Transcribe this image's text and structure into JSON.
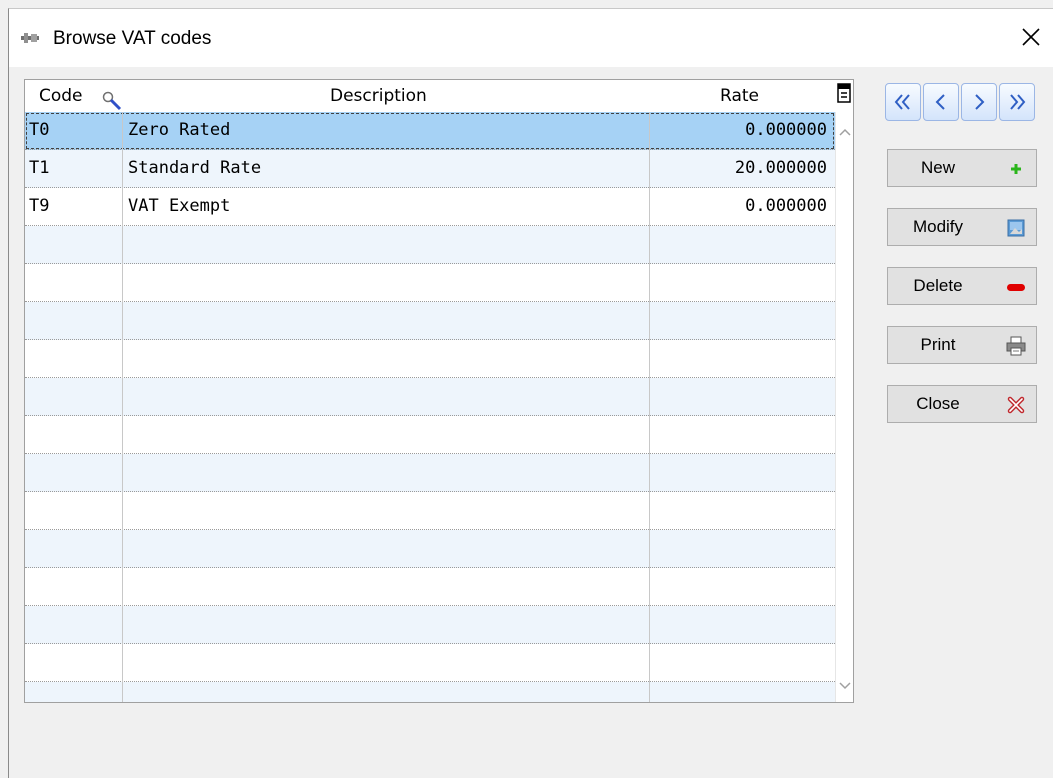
{
  "window": {
    "title": "Browse VAT codes"
  },
  "grid": {
    "columns": [
      "Code",
      "Description",
      "Rate"
    ],
    "rows": [
      {
        "code": "T0",
        "description": "Zero Rated",
        "rate": "0.000000",
        "selected": true
      },
      {
        "code": "T1",
        "description": "Standard Rate",
        "rate": "20.000000",
        "selected": false
      },
      {
        "code": "T9",
        "description": "VAT Exempt",
        "rate": "0.000000",
        "selected": false
      },
      {
        "code": "",
        "description": "",
        "rate": ""
      },
      {
        "code": "",
        "description": "",
        "rate": ""
      },
      {
        "code": "",
        "description": "",
        "rate": ""
      },
      {
        "code": "",
        "description": "",
        "rate": ""
      },
      {
        "code": "",
        "description": "",
        "rate": ""
      },
      {
        "code": "",
        "description": "",
        "rate": ""
      },
      {
        "code": "",
        "description": "",
        "rate": ""
      },
      {
        "code": "",
        "description": "",
        "rate": ""
      },
      {
        "code": "",
        "description": "",
        "rate": ""
      },
      {
        "code": "",
        "description": "",
        "rate": ""
      },
      {
        "code": "",
        "description": "",
        "rate": ""
      },
      {
        "code": "",
        "description": "",
        "rate": ""
      },
      {
        "code": "",
        "description": "",
        "rate": ""
      }
    ]
  },
  "buttons": {
    "new": "New",
    "modify": "Modify",
    "delete": "Delete",
    "print": "Print",
    "close": "Close"
  },
  "colors": {
    "selected_row": "#a6d2f5",
    "alt_row": "#eef5fc",
    "nav_border": "#9bb6e5",
    "new_icon": "#2ab51b",
    "delete_icon": "#e00000",
    "close_icon": "#c0282d"
  }
}
